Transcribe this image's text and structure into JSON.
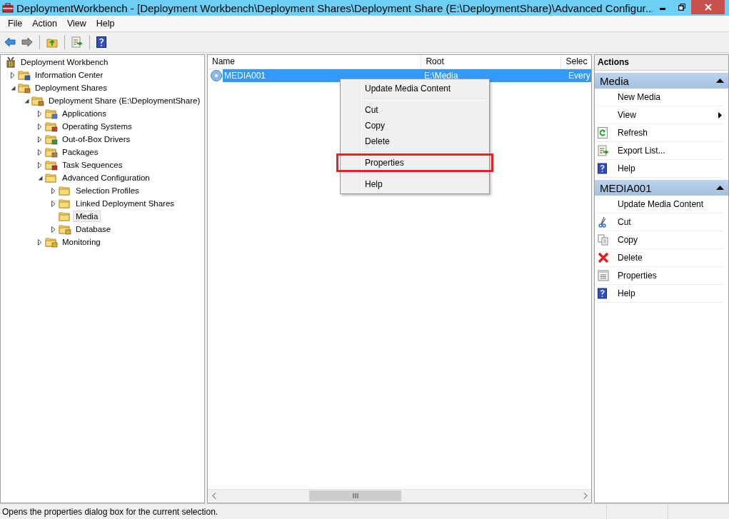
{
  "window": {
    "title": "DeploymentWorkbench - [Deployment Workbench\\Deployment Shares\\Deployment Share (E:\\DeploymentShare)\\Advanced Configur..."
  },
  "menu_bar": [
    "File",
    "Action",
    "View",
    "Help"
  ],
  "tree": [
    {
      "label": "Deployment Workbench",
      "kind": "workbench",
      "selected": false,
      "children": [
        {
          "label": "Information Center",
          "kind": "info",
          "expandable": true,
          "expanded": false,
          "selected": false
        },
        {
          "label": "Deployment Shares",
          "kind": "share",
          "expandable": true,
          "expanded": true,
          "selected": false,
          "children": [
            {
              "label": "Deployment Share (E:\\DeploymentShare)",
              "kind": "share",
              "expandable": true,
              "expanded": true,
              "selected": false,
              "children": [
                {
                  "label": "Applications",
                  "kind": "apps",
                  "expandable": true,
                  "expanded": false,
                  "selected": false
                },
                {
                  "label": "Operating Systems",
                  "kind": "os",
                  "expandable": true,
                  "expanded": false,
                  "selected": false
                },
                {
                  "label": "Out-of-Box Drivers",
                  "kind": "drivers",
                  "expandable": true,
                  "expanded": false,
                  "selected": false
                },
                {
                  "label": "Packages",
                  "kind": "packages",
                  "expandable": true,
                  "expanded": false,
                  "selected": false
                },
                {
                  "label": "Task Sequences",
                  "kind": "tasks",
                  "expandable": true,
                  "expanded": false,
                  "selected": false
                },
                {
                  "label": "Advanced Configuration",
                  "kind": "folder",
                  "expandable": true,
                  "expanded": true,
                  "selected": false,
                  "children": [
                    {
                      "label": "Selection Profiles",
                      "kind": "folder",
                      "expandable": true,
                      "expanded": false,
                      "selected": false
                    },
                    {
                      "label": "Linked Deployment Shares",
                      "kind": "folder",
                      "expandable": true,
                      "expanded": false,
                      "selected": false
                    },
                    {
                      "label": "Media",
                      "kind": "folder",
                      "selected": true
                    },
                    {
                      "label": "Database",
                      "kind": "database",
                      "expandable": true,
                      "expanded": false,
                      "selected": false
                    }
                  ]
                },
                {
                  "label": "Monitoring",
                  "kind": "database",
                  "expandable": true,
                  "expanded": false,
                  "selected": false
                }
              ]
            }
          ]
        }
      ]
    }
  ],
  "table": {
    "columns": [
      "Name",
      "Root",
      "Selec"
    ],
    "rows": [
      {
        "cells": [
          "MEDIA001",
          "E:\\Media",
          "Every"
        ],
        "selected": true
      }
    ]
  },
  "context_menu": [
    {
      "kind": "item",
      "label": "Update Media Content",
      "highlighted": false
    },
    {
      "kind": "separator"
    },
    {
      "kind": "item",
      "label": "Cut",
      "highlighted": false
    },
    {
      "kind": "item",
      "label": "Copy",
      "highlighted": false
    },
    {
      "kind": "item",
      "label": "Delete",
      "highlighted": false
    },
    {
      "kind": "separator"
    },
    {
      "kind": "item",
      "label": "Properties",
      "highlighted": true
    },
    {
      "kind": "separator"
    },
    {
      "kind": "item",
      "label": "Help",
      "highlighted": false
    }
  ],
  "actions": {
    "title": "Actions",
    "sections": [
      {
        "title": "Media",
        "items": [
          {
            "label": "New Media",
            "kind": "plain",
            "submenu": false
          },
          {
            "label": "View",
            "kind": "plain",
            "submenu": true
          },
          {
            "label": "Refresh",
            "kind": "refresh",
            "submenu": false
          },
          {
            "label": "Export List...",
            "kind": "export",
            "submenu": false
          },
          {
            "label": "Help",
            "kind": "help",
            "submenu": false
          }
        ]
      },
      {
        "title": "MEDIA001",
        "items": [
          {
            "label": "Update Media Content",
            "kind": "plain",
            "submenu": false
          },
          {
            "label": "Cut",
            "kind": "cut",
            "submenu": false
          },
          {
            "label": "Copy",
            "kind": "copy",
            "submenu": false
          },
          {
            "label": "Delete",
            "kind": "delete",
            "submenu": false
          },
          {
            "label": "Properties",
            "kind": "properties",
            "submenu": false
          },
          {
            "label": "Help",
            "kind": "help",
            "submenu": false
          }
        ]
      }
    ]
  },
  "status_bar": "Opens the properties dialog box for the current selection."
}
